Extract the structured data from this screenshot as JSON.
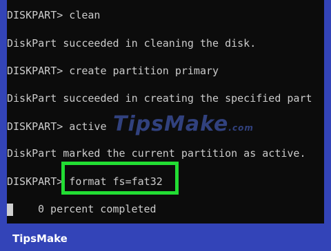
{
  "terminal": {
    "lines": [
      "DISKPART> clean",
      "DiskPart succeeded in cleaning the disk.",
      "DISKPART> create partition primary",
      "DiskPart succeeded in creating the specified part",
      "DISKPART> active",
      "DiskPart marked the current partition as active.",
      "DISKPART> format fs=fat32"
    ],
    "progress": "0 percent completed",
    "highlight_color": "#22dd33",
    "background": "#0c0c0c",
    "text_color": "#cccccc"
  },
  "watermark": {
    "text": "TipsMake",
    "suffix": ".com"
  },
  "footer": {
    "brand": "TipsMake",
    "background": "#3344b8"
  }
}
